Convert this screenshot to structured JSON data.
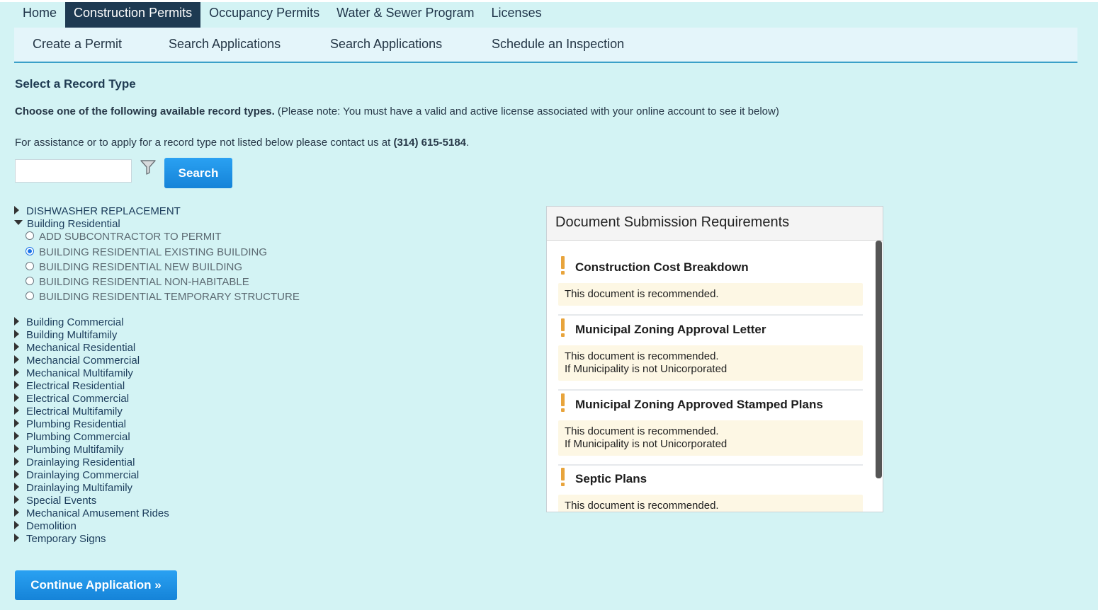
{
  "top_nav": {
    "tabs": [
      {
        "label": "Home"
      },
      {
        "label": "Construction Permits"
      },
      {
        "label": "Occupancy Permits"
      },
      {
        "label": "Water & Sewer Program"
      },
      {
        "label": "Licenses"
      }
    ],
    "active": "Construction Permits"
  },
  "sub_nav": {
    "items": [
      {
        "label": "Create a Permit"
      },
      {
        "label": "Search Applications"
      },
      {
        "label": "Search Applications"
      },
      {
        "label": "Schedule an Inspection"
      }
    ]
  },
  "page": {
    "title": "Select a Record Type",
    "instruction_bold": "Choose one of the following available record types.",
    "instruction_rest": " (Please note: You must have a valid and active license associated with your online account to see it below)",
    "assist_text": "For assistance or to apply for a record type not listed below please contact us at ",
    "assist_phone": "(314) 615-5184",
    "assist_end": "."
  },
  "search": {
    "input_value": "",
    "button_label": "Search"
  },
  "tree": {
    "top_item": "DISHWASHER REPLACEMENT",
    "expanded_group": "Building Residential",
    "options": [
      {
        "label": "ADD SUBCONTRACTOR TO PERMIT",
        "checked": false
      },
      {
        "label": "BUILDING RESIDENTIAL EXISTING BUILDING",
        "checked": true
      },
      {
        "label": "BUILDING RESIDENTIAL NEW BUILDING",
        "checked": false
      },
      {
        "label": "BUILDING RESIDENTIAL NON-HABITABLE",
        "checked": false
      },
      {
        "label": "BUILDING RESIDENTIAL TEMPORARY STRUCTURE",
        "checked": false
      }
    ],
    "collapsed_groups": [
      "Building Commercial",
      "Building Multifamily",
      "Mechanical Residential",
      "Mechancial Commercial",
      "Mechanical Multifamily",
      "Electrical Residential",
      "Electrical Commercial",
      "Electrical Multifamily",
      "Plumbing Residential",
      "Plumbing Commercial",
      "Plumbing Multifamily",
      "Drainlaying Residential",
      "Drainlaying Commercial",
      "Drainlaying Multifamily",
      "Special Events",
      "Mechanical Amusement Rides",
      "Demolition",
      "Temporary Signs"
    ]
  },
  "requirements": {
    "title": "Document Submission Requirements",
    "items": [
      {
        "name": "Construction Cost Breakdown",
        "line1": "This document is recommended.",
        "line2": ""
      },
      {
        "name": "Municipal Zoning Approval Letter",
        "line1": "This document is recommended.",
        "line2": "If Municipality is not Unicorporated"
      },
      {
        "name": "Municipal Zoning Approved Stamped Plans",
        "line1": "This document is recommended.",
        "line2": "If Municipality is not Unicorporated"
      },
      {
        "name": "Septic Plans",
        "line1": "This document is recommended.",
        "line2": ""
      }
    ]
  },
  "footer": {
    "continue_label": "Continue Application »"
  },
  "colors": {
    "page_bg": "#d3f3f4",
    "active_tab": "#1e3a52",
    "button": "#1e8fe6",
    "warning": "#e8a43c"
  }
}
